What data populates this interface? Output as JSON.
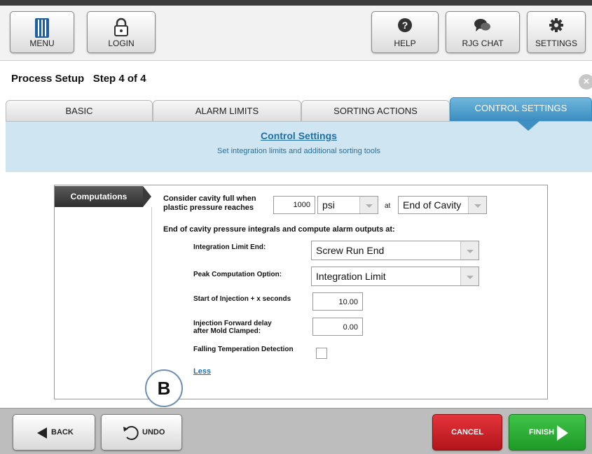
{
  "toolbar": {
    "menu_label": "MENU",
    "login_label": "LOGIN",
    "help_label": "HELP",
    "chat_label": "RJG CHAT",
    "settings_label": "SETTINGS"
  },
  "header": {
    "title": "Process Setup   Step 4 of 4",
    "close_symbol": "×"
  },
  "tabs": [
    {
      "label": "BASIC",
      "active": false
    },
    {
      "label": "ALARM LIMITS",
      "active": false
    },
    {
      "label": "SORTING ACTIONS",
      "active": false
    },
    {
      "label": "CONTROL SETTINGS",
      "active": true
    }
  ],
  "banner": {
    "title": "Control Settings",
    "subtitle": "Set integration limits and additional sorting tools"
  },
  "panel": {
    "side_tab_label": "Computations",
    "cavity_full_label_1": "Consider cavity full when",
    "cavity_full_label_2": "plastic pressure reaches",
    "pressure_value": "1000",
    "pressure_unit": "psi",
    "at_label": "at",
    "location_value": "End of Cavity",
    "integrals_heading": "End of cavity pressure integrals and compute alarm outputs at:",
    "integration_limit_label": "Integration Limit End:",
    "integration_limit_value": "Screw Run End",
    "peak_option_label": "Peak Computation Option:",
    "peak_option_value": "Integration Limit",
    "start_injection_label": "Start of Injection + x seconds",
    "start_injection_value": "10.00",
    "injection_delay_label_1": "Injection Forward delay",
    "injection_delay_label_2": "after Mold Clamped:",
    "injection_delay_value": "0.00",
    "falling_temp_label": "Falling Temperation Detection",
    "less_link": "Less"
  },
  "callout": {
    "label": "B"
  },
  "footer": {
    "back_label": "BACK",
    "undo_label": "UNDO",
    "cancel_label": "CANCEL",
    "finish_label": "FINISH"
  },
  "colors": {
    "accent_blue": "#3a8cbf",
    "banner_bg": "#cfe6f2",
    "cancel_red": "#c8202a",
    "finish_green": "#2aa833"
  }
}
